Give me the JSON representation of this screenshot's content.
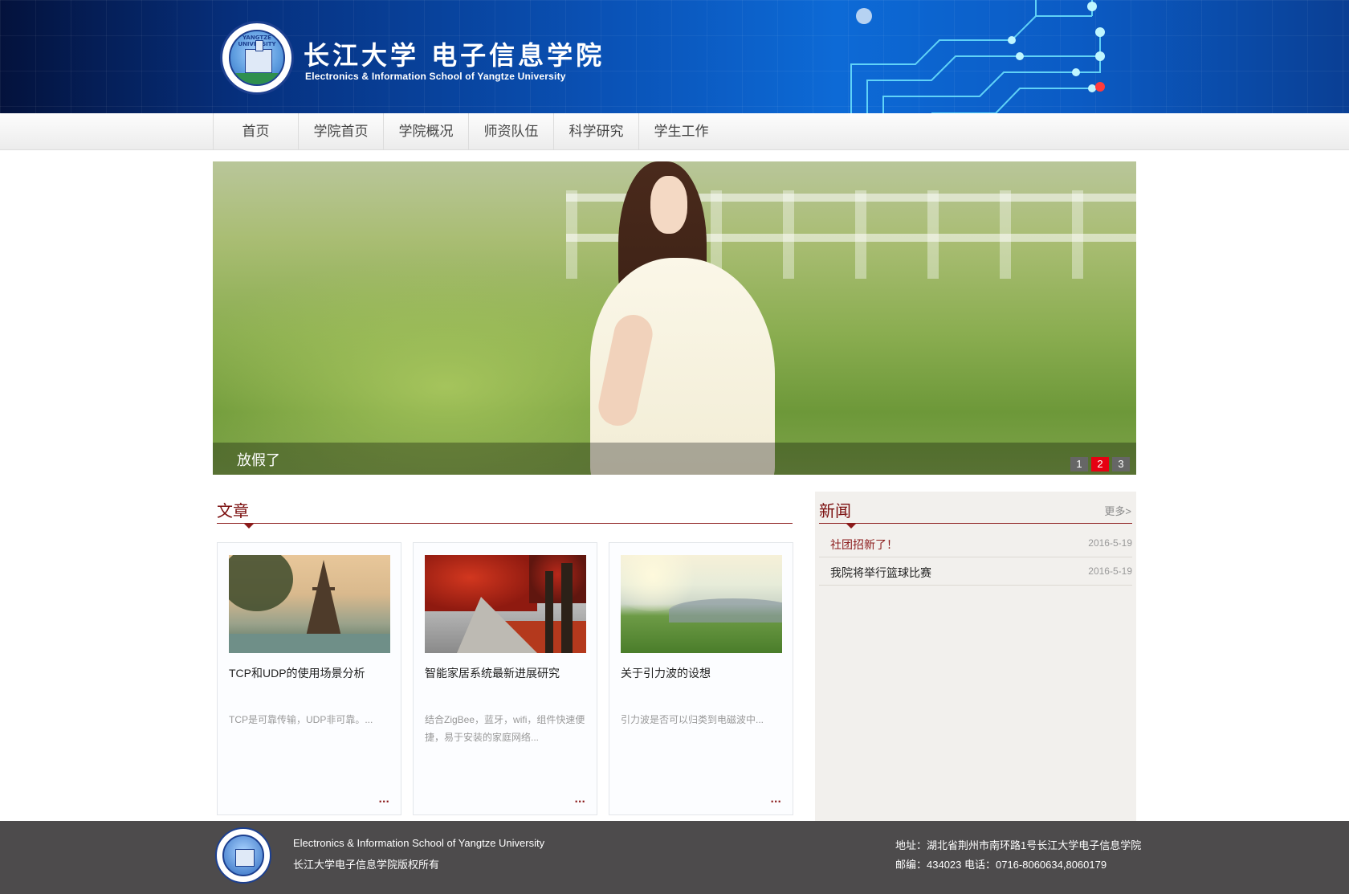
{
  "header": {
    "seal_text": "YANGTZE UNIVERSITY",
    "title_cn": "长江大学 电子信息学院",
    "title_en": "Electronics & Information School of Yangtze University"
  },
  "nav": {
    "items": [
      "首页",
      "学院首页",
      "学院概况",
      "师资队伍",
      "科学研究",
      "学生工作"
    ]
  },
  "slider": {
    "caption": "放假了",
    "pages": [
      "1",
      "2",
      "3"
    ],
    "active_page": 2,
    "active_color": "#e60012"
  },
  "articles": {
    "title": "文章",
    "cards": [
      {
        "title": "TCP和UDP的使用场景分析",
        "desc": "TCP是可靠传输，UDP非可靠。...",
        "more": "...",
        "image": "eiffel-tower"
      },
      {
        "title": "智能家居系统最新进展研究",
        "desc": "结合ZigBee，蓝牙，wifi，组件快速便捷，易于安装的家庭网络...",
        "more": "...",
        "image": "autumn-road"
      },
      {
        "title": "关于引力波的设想",
        "desc": "引力波是否可以归类到电磁波中...",
        "more": "...",
        "image": "green-field"
      }
    ]
  },
  "news": {
    "title": "新闻",
    "more": "更多>",
    "items": [
      {
        "title": "社团招新了！",
        "date": "2016-5-19",
        "highlighted": true
      },
      {
        "title": "我院将举行篮球比赛",
        "date": "2016-5-19",
        "highlighted": false
      }
    ]
  },
  "footer": {
    "left_line1": "Electronics & Information School of Yangtze University",
    "left_line2": "长江大学电子信息学院版权所有",
    "right_line1": "地址：湖北省荆州市南环路1号长江大学电子信息学院",
    "right_line2": "邮编：434023 电话：0716-8060634,8060179"
  },
  "colors": {
    "accent": "#8b1a1a",
    "banner_blue": "#0a52b6",
    "footer_bg": "#4d4b4c"
  }
}
